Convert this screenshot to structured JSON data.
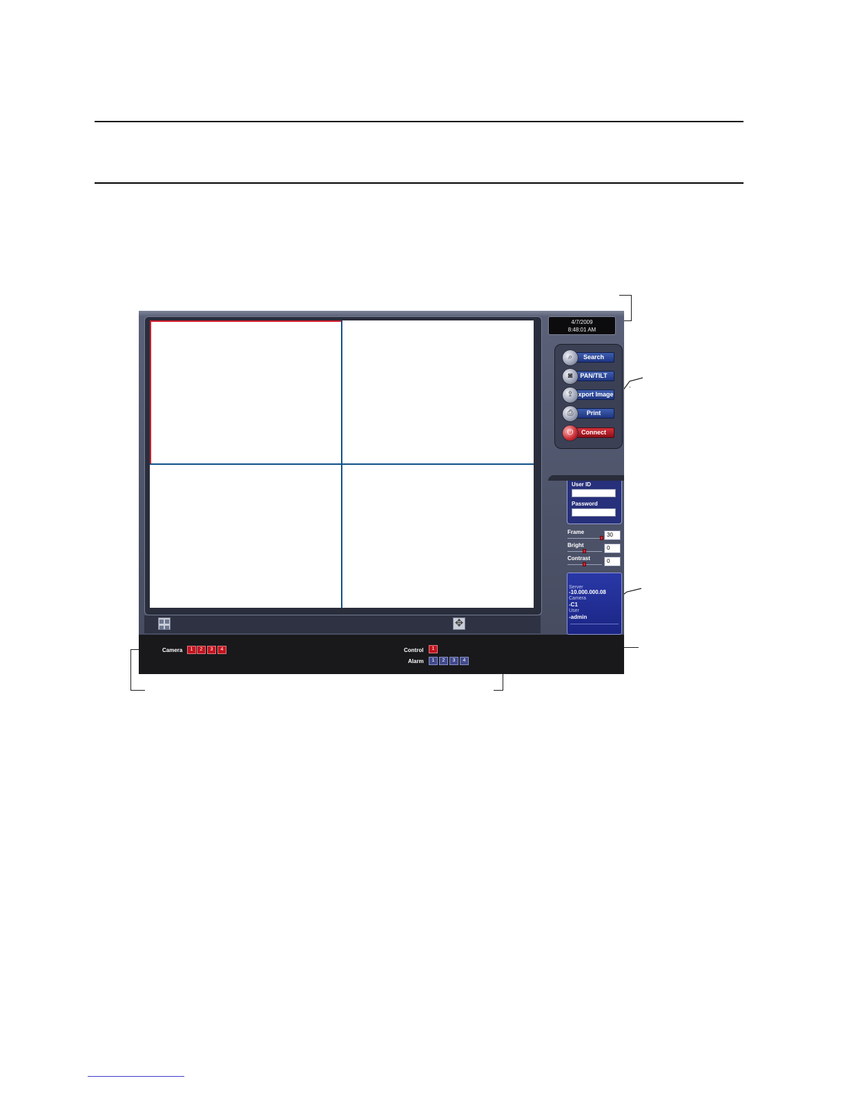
{
  "clock": {
    "date": "4/7/2009",
    "time": "8:48:01 AM"
  },
  "buttons": [
    {
      "label": "Search",
      "icon": "magnifier-icon"
    },
    {
      "label": "PAN/TILT",
      "icon": "ptz-camera-icon"
    },
    {
      "label": "Export Image",
      "icon": "export-icon"
    },
    {
      "label": "Print",
      "icon": "printer-icon"
    },
    {
      "label": "Connect",
      "icon": "connect-icon"
    }
  ],
  "login": {
    "user_id_label": "User ID",
    "password_label": "Password",
    "user_id_value": "",
    "password_value": ""
  },
  "sliders": [
    {
      "label": "Frame",
      "value": "30",
      "level": 1.0
    },
    {
      "label": "Bright",
      "value": "0",
      "level": 0.5
    },
    {
      "label": "Contrast",
      "value": "0",
      "level": 0.5
    }
  ],
  "info": {
    "server_label": "Server",
    "server_value": "-10.000.000.08",
    "camera_label": "Camera",
    "camera_value": "-C1",
    "user_label": "User",
    "user_value": "-admin"
  },
  "bottom": {
    "camera_label": "Camera",
    "camera_buttons": [
      "1",
      "2",
      "3",
      "4"
    ],
    "control_label": "Control",
    "control_buttons": [
      "1"
    ],
    "alarm_label": "Alarm",
    "alarm_buttons": [
      "1",
      "2",
      "3",
      "4"
    ]
  },
  "toolbar": {
    "layout_icon": "quad-layout-icon",
    "move_icon": "move-arrows-icon"
  },
  "colors": {
    "active_border": "#d61c2b",
    "grid_border": "#0f4f86",
    "panel_bg": "#4d5369",
    "button_blue": "#1f3682",
    "button_red": "#8f0f18"
  }
}
